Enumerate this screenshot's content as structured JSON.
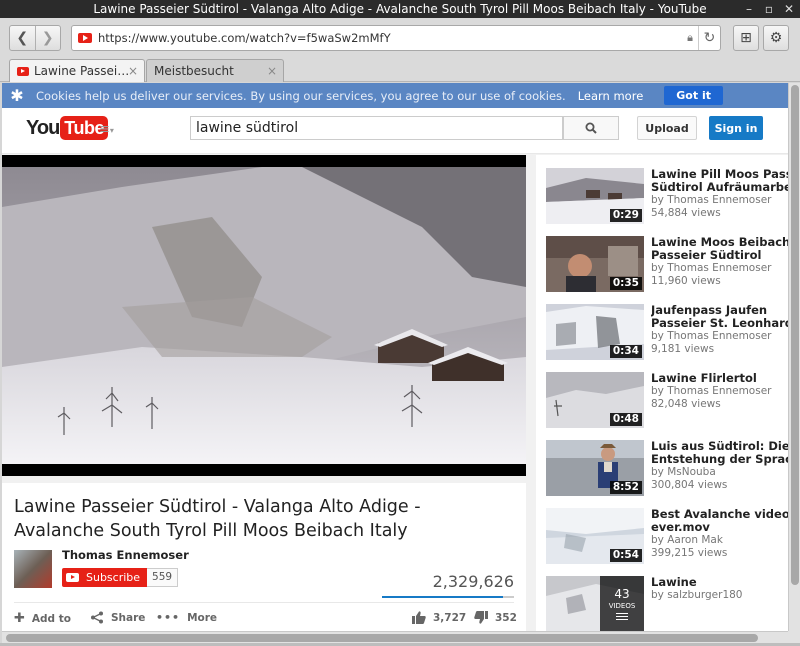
{
  "window": {
    "title": "Lawine Passeier Südtirol - Valanga Alto Adige - Avalanche South Tyrol Pill Moos Beibach Italy - YouTube",
    "btn_min": "–",
    "btn_max": "▫",
    "btn_close": "✕"
  },
  "browser": {
    "url": "https://www.youtube.com/watch?v=f5waSw2mMfY",
    "tabs": [
      {
        "label": "Lawine Passei…",
        "close": "×"
      },
      {
        "label": "Meistbesucht",
        "close": "×"
      }
    ]
  },
  "cookie_banner": {
    "message": "Cookies help us deliver our services. By using our services, you agree to our use of cookies.",
    "learn_more": "Learn more",
    "got_it": "Got it"
  },
  "masthead": {
    "logo_you": "You",
    "logo_tube": "Tube",
    "search_value": "lawine südtirol",
    "upload": "Upload",
    "sign_in": "Sign in"
  },
  "video": {
    "title": "Lawine Passeier Südtirol - Valanga Alto Adige - Avalanche South Tyrol Pill Moos Beibach Italy",
    "channel": "Thomas Ennemoser",
    "subscribe": "Subscribe",
    "subscriber_count": "559",
    "views": "2,329,626",
    "like_fraction": 0.914,
    "actions": {
      "add_to": "Add to",
      "share": "Share",
      "more": "More"
    },
    "likes": "3,727",
    "dislikes": "352"
  },
  "related": [
    {
      "title1": "Lawine Pill Moos Passeier",
      "title2": "Südtirol Aufräumarbeiten",
      "by": "by Thomas Ennemoser",
      "views": "54,884 views",
      "duration": "0:29"
    },
    {
      "title1": "Lawine Moos Beibach Pill",
      "title2": "Passeier Südtirol",
      "by": "by Thomas Ennemoser",
      "views": "11,960 views",
      "duration": "0:35"
    },
    {
      "title1": "Jaufenpass Jaufen",
      "title2": "Passeier St. Leonhard",
      "by": "by Thomas Ennemoser",
      "views": "9,181 views",
      "duration": "0:34"
    },
    {
      "title1": "Lawine Flirlertol",
      "title2": "",
      "by": "by Thomas Ennemoser",
      "views": "82,048 views",
      "duration": "0:48"
    },
    {
      "title1": "Luis aus Südtirol: Die",
      "title2": "Entstehung der Sprache",
      "by": "by MsNouba",
      "views": "300,804 views",
      "duration": "8:52"
    },
    {
      "title1": "Best Avalanche video",
      "title2": "ever.mov",
      "by": "by Aaron Mak",
      "views": "399,215 views",
      "duration": "0:54"
    },
    {
      "title1": "Lawine",
      "title2": "",
      "by": "by salzburger180",
      "views": "",
      "playlist_count": "43",
      "playlist_label": "VIDEOS"
    }
  ]
}
